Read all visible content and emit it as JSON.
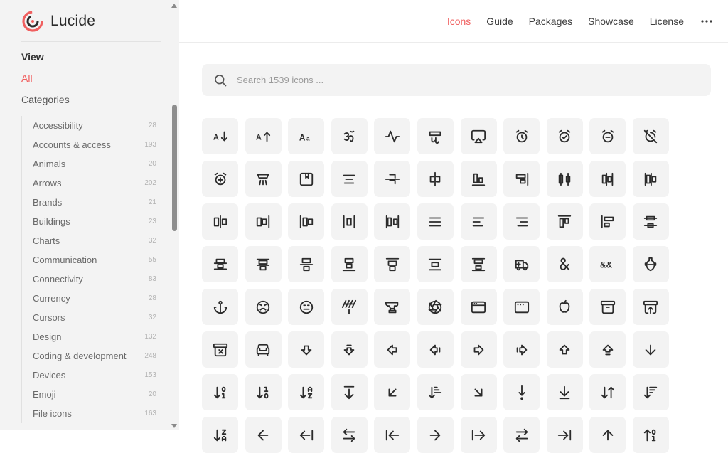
{
  "brand": {
    "name": "Lucide",
    "accent": "#f05f5f"
  },
  "nav": {
    "items": [
      {
        "label": "Icons",
        "active": true
      },
      {
        "label": "Guide"
      },
      {
        "label": "Packages"
      },
      {
        "label": "Showcase"
      },
      {
        "label": "License"
      }
    ],
    "more_icon": "more-horizontal-icon"
  },
  "sidebar": {
    "view_title": "View",
    "all_label": "All",
    "categories_label": "Categories",
    "categories": [
      {
        "label": "Accessibility",
        "count": "28"
      },
      {
        "label": "Accounts & access",
        "count": "193"
      },
      {
        "label": "Animals",
        "count": "20"
      },
      {
        "label": "Arrows",
        "count": "202"
      },
      {
        "label": "Brands",
        "count": "21"
      },
      {
        "label": "Buildings",
        "count": "23"
      },
      {
        "label": "Charts",
        "count": "32"
      },
      {
        "label": "Communication",
        "count": "55"
      },
      {
        "label": "Connectivity",
        "count": "83"
      },
      {
        "label": "Currency",
        "count": "28"
      },
      {
        "label": "Cursors",
        "count": "32"
      },
      {
        "label": "Design",
        "count": "132"
      },
      {
        "label": "Coding & development",
        "count": "248"
      },
      {
        "label": "Devices",
        "count": "153"
      },
      {
        "label": "Emoji",
        "count": "20"
      },
      {
        "label": "File icons",
        "count": "163"
      }
    ]
  },
  "search": {
    "placeholder": "Search 1539 icons ..."
  },
  "icons": [
    "a-arrow-down",
    "a-arrow-up",
    "a-large-small",
    "accessibility-om",
    "activity",
    "air-vent",
    "airplay",
    "alarm-clock",
    "alarm-clock-check",
    "alarm-clock-minus",
    "alarm-clock-off",
    "alarm-clock-plus",
    "alarm-smoke",
    "album",
    "align-center",
    "align-center-horizontal",
    "align-center-vertical",
    "align-end-horizontal",
    "align-end-vertical",
    "align-horizontal-distribute-center",
    "align-horizontal-distribute-end",
    "align-horizontal-distribute-start",
    "align-horizontal-justify-center",
    "align-horizontal-justify-end",
    "align-horizontal-justify-start",
    "align-horizontal-space-around",
    "align-horizontal-space-between",
    "align-justify",
    "align-left",
    "align-right",
    "align-start-horizontal",
    "align-start-vertical",
    "align-vertical-distribute-center",
    "align-vertical-distribute-end",
    "align-vertical-distribute-start",
    "align-vertical-justify-center",
    "align-vertical-justify-end",
    "align-vertical-justify-start",
    "align-vertical-space-around",
    "align-vertical-space-between",
    "ambulance",
    "ampersand",
    "ampersands",
    "amphora",
    "anchor",
    "angry",
    "annoyed",
    "antenna",
    "anvil",
    "aperture",
    "app-window",
    "app-window-mac",
    "apple",
    "archive",
    "archive-restore",
    "archive-x",
    "armchair",
    "arrow-big-down",
    "arrow-big-down-dash",
    "arrow-big-left",
    "arrow-big-left-dash",
    "arrow-big-right",
    "arrow-big-right-dash",
    "arrow-big-up",
    "arrow-big-up-dash",
    "arrow-down",
    "arrow-down-0-1",
    "arrow-down-1-0",
    "arrow-down-a-z",
    "arrow-down-from-line",
    "arrow-down-left",
    "arrow-down-narrow-wide",
    "arrow-down-right",
    "arrow-down-to-dot",
    "arrow-down-to-line",
    "arrow-down-up",
    "arrow-down-wide-narrow",
    "arrow-down-z-a",
    "arrow-left",
    "arrow-left-from-line",
    "arrow-left-right",
    "arrow-left-to-line",
    "arrow-right",
    "arrow-right-from-line",
    "arrow-right-left",
    "arrow-right-to-line",
    "arrow-up",
    "arrow-up-0-1"
  ]
}
